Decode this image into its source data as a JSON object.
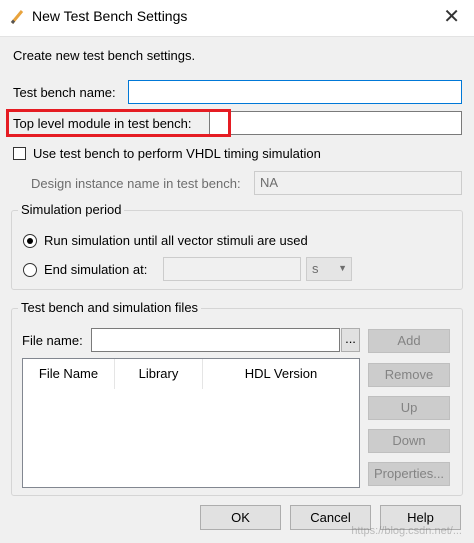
{
  "window": {
    "title": "New Test Bench Settings",
    "close_symbol": "✕"
  },
  "intro": "Create new test bench settings.",
  "test_bench_name": {
    "label": "Test bench name:",
    "value": ""
  },
  "top_level_module": {
    "label": "Top level module in test bench:",
    "value": ""
  },
  "vhdl_timing": {
    "label": "Use test bench to perform VHDL timing simulation",
    "checked": false
  },
  "design_instance": {
    "label": "Design instance name in test bench:",
    "value": "NA"
  },
  "simulation_period": {
    "title": "Simulation period",
    "run_until_label": "Run simulation until all vector stimuli are used",
    "end_at_label": "End simulation at:",
    "end_at_value": "",
    "unit": "s"
  },
  "files": {
    "title": "Test bench and simulation files",
    "file_name_label": "File name:",
    "browse_label": "...",
    "columns": [
      "File Name",
      "Library",
      "HDL Version"
    ],
    "buttons": {
      "add": "Add",
      "remove": "Remove",
      "up": "Up",
      "down": "Down",
      "properties": "Properties..."
    }
  },
  "footer": {
    "ok": "OK",
    "cancel": "Cancel",
    "help": "Help"
  },
  "watermark": "https://blog.csdn.net/...",
  "colors": {
    "highlight": "#e51c23",
    "focus": "#0078d7"
  }
}
